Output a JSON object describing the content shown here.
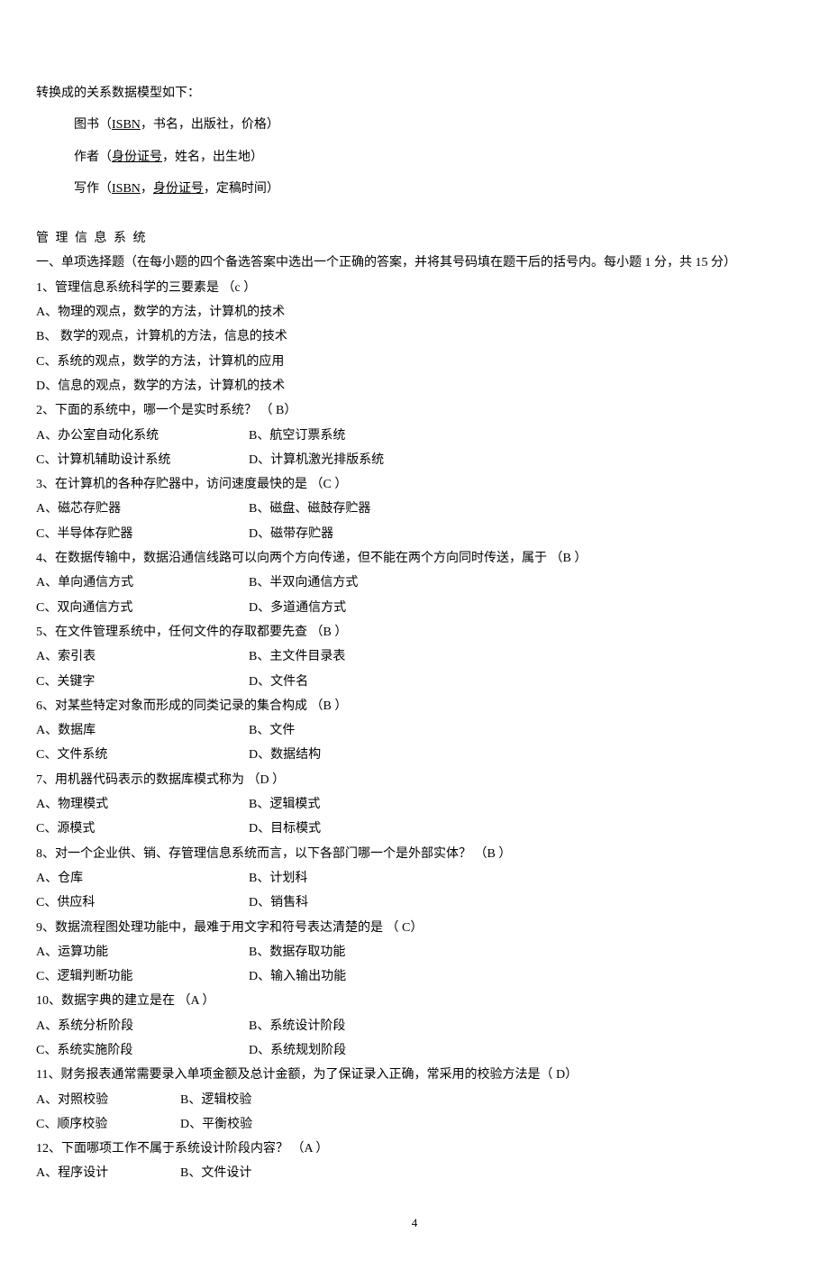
{
  "intro": {
    "line1": "转换成的关系数据模型如下：",
    "book_pre": "图书（",
    "book_u": "ISBN",
    "book_post": "，书名，出版社，价格）",
    "author_pre": "作者（",
    "author_u": "身份证号",
    "author_post": "，姓名，出生地）",
    "write_pre": "写作（",
    "write_u1": "ISBN",
    "write_mid": "，",
    "write_u2": "身份证号",
    "write_post": "，定稿时间）"
  },
  "title": "管 理 信 息 系 统",
  "section_heading": "一、单项选择题（在每小题的四个备选答案中选出一个正确的答案，并将其号码填在题干后的括号内。每小题 1 分，共 15 分）",
  "q1": {
    "stem": "1、管理信息系统科学的三要素是 （c ）",
    "a": "A、物理的观点，数学的方法，计算机的技术",
    "b": "B、 数学的观点，计算机的方法，信息的技术",
    "c": "C、系统的观点，数学的方法，计算机的应用",
    "d": "D、信息的观点，数学的方法，计算机的技术"
  },
  "q2": {
    "stem": "2、下面的系统中，哪一个是实时系统？ （ B）",
    "a": "A、办公室自动化系统",
    "b": "B、航空订票系统",
    "c": "C、计算机辅助设计系统",
    "d": "D、计算机激光排版系统"
  },
  "q3": {
    "stem": "3、在计算机的各种存贮器中，访问速度最快的是 （C ）",
    "a": "A、磁芯存贮器",
    "b": "B、磁盘、磁鼓存贮器",
    "c": "C、半导体存贮器",
    "d": "D、磁带存贮器"
  },
  "q4": {
    "stem": "4、在数据传输中，数据沿通信线路可以向两个方向传递，但不能在两个方向同时传送，属于 （B ）",
    "a": "A、单向通信方式",
    "b": "B、半双向通信方式",
    "c": "C、双向通信方式",
    "d": "D、多道通信方式"
  },
  "q5": {
    "stem": "5、在文件管理系统中，任何文件的存取都要先查 （B ）",
    "a": "A、索引表",
    "b": "B、主文件目录表",
    "c": "C、关键字",
    "d": "D、文件名"
  },
  "q6": {
    "stem": "6、对某些特定对象而形成的同类记录的集合构成 （B ）",
    "a": "A、数据库",
    "b": "B、文件",
    "c": "C、文件系统",
    "d": "D、数据结构"
  },
  "q7": {
    "stem": "7、用机器代码表示的数据库模式称为 （D ）",
    "a": "A、物理模式",
    "b": "B、逻辑模式",
    "c": "C、源模式",
    "d": "D、目标模式"
  },
  "q8": {
    "stem": "8、对一个企业供、销、存管理信息系统而言，以下各部门哪一个是外部实体？ （B ）",
    "a": "A、仓库",
    "b": "B、计划科",
    "c": "C、供应科",
    "d": "D、销售科"
  },
  "q9": {
    "stem": "9、数据流程图处理功能中，最难于用文字和符号表达清楚的是 （ C）",
    "a": "A、运算功能",
    "b": "B、数据存取功能",
    "c": "C、逻辑判断功能",
    "d": "D、输入输出功能"
  },
  "q10": {
    "stem": "10、数据字典的建立是在 （A ）",
    "a": "A、系统分析阶段",
    "b": "B、系统设计阶段",
    "c": "C、系统实施阶段",
    "d": "D、系统规划阶段"
  },
  "q11": {
    "stem": "11、财务报表通常需要录入单项金额及总计金额，为了保证录入正确，常采用的校验方法是（ D）",
    "a": "A、对照校验",
    "b": "B、逻辑校验",
    "c": "C、顺序校验",
    "d": "D、平衡校验"
  },
  "q12": {
    "stem": "12、下面哪项工作不属于系统设计阶段内容？ （A ）",
    "a": "A、程序设计",
    "b": "B、文件设计"
  },
  "page_number": "4"
}
